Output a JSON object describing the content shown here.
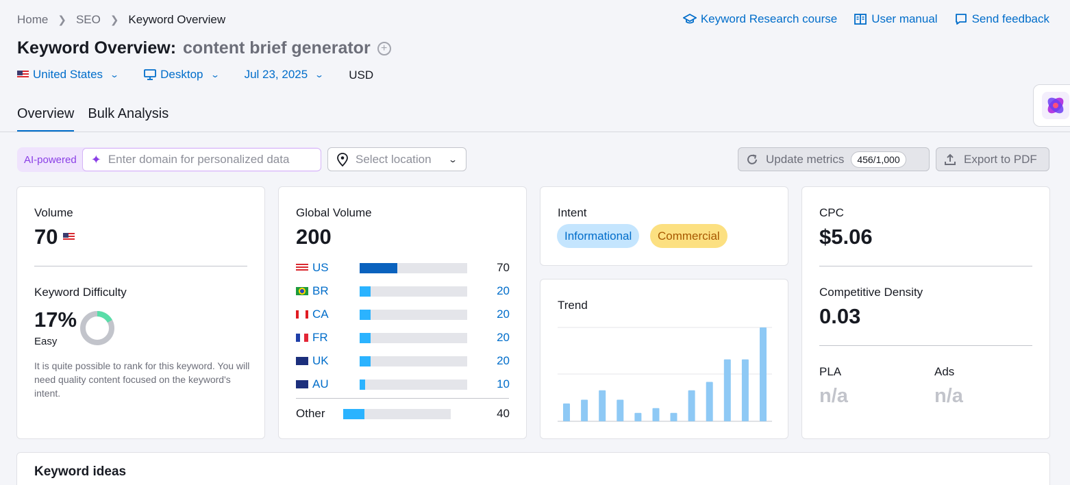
{
  "breadcrumb": [
    "Home",
    "SEO",
    "Keyword Overview"
  ],
  "top_links": {
    "course": "Keyword Research course",
    "manual": "User manual",
    "feedback": "Send feedback"
  },
  "title": {
    "prefix": "Keyword Overview:",
    "keyword": "content brief generator"
  },
  "filters": {
    "country": "United States",
    "device": "Desktop",
    "date": "Jul 23, 2025",
    "currency": "USD"
  },
  "tabs": [
    "Overview",
    "Bulk Analysis"
  ],
  "toolbar": {
    "ai_label": "AI-powered",
    "domain_placeholder": "Enter domain for personalized data",
    "location_placeholder": "Select location",
    "update_label": "Update metrics",
    "update_count": "456/1,000",
    "export_label": "Export to PDF"
  },
  "volume_card": {
    "label": "Volume",
    "value": "70",
    "kd_label": "Keyword Difficulty",
    "kd_value": "17%",
    "kd_level": "Easy",
    "kd_percent": 17,
    "kd_desc": "It is quite possible to rank for this keyword. You will need quality content focused on the keyword's intent."
  },
  "global_card": {
    "label": "Global Volume",
    "value": "200",
    "countries": [
      {
        "code": "US",
        "value": "70",
        "share": 0.35
      },
      {
        "code": "BR",
        "value": "20",
        "share": 0.1
      },
      {
        "code": "CA",
        "value": "20",
        "share": 0.1
      },
      {
        "code": "FR",
        "value": "20",
        "share": 0.1
      },
      {
        "code": "UK",
        "value": "20",
        "share": 0.1
      },
      {
        "code": "AU",
        "value": "10",
        "share": 0.05
      }
    ],
    "other": {
      "label": "Other",
      "value": "40",
      "share": 0.2
    }
  },
  "intent_card": {
    "label": "Intent",
    "tags": [
      "Informational",
      "Commercial"
    ]
  },
  "trend_card": {
    "label": "Trend"
  },
  "cpc_card": {
    "label": "CPC",
    "value": "$5.06",
    "cd_label": "Competitive Density",
    "cd_value": "0.03",
    "pla_label": "PLA",
    "pla_value": "n/a",
    "ads_label": "Ads",
    "ads_value": "n/a"
  },
  "ideas": {
    "title": "Keyword ideas"
  },
  "colors": {
    "accent": "#006dca",
    "bar_light": "#2bb3ff",
    "bar_dark": "#0a62be",
    "trend_bar": "#8ec9f5",
    "kd_green": "#59dda8"
  },
  "chart_data": {
    "type": "bar",
    "title": "Trend",
    "values": [
      19,
      23,
      33,
      23,
      9,
      14,
      9,
      33,
      42,
      66,
      66,
      100
    ],
    "ylim": [
      0,
      100
    ]
  }
}
